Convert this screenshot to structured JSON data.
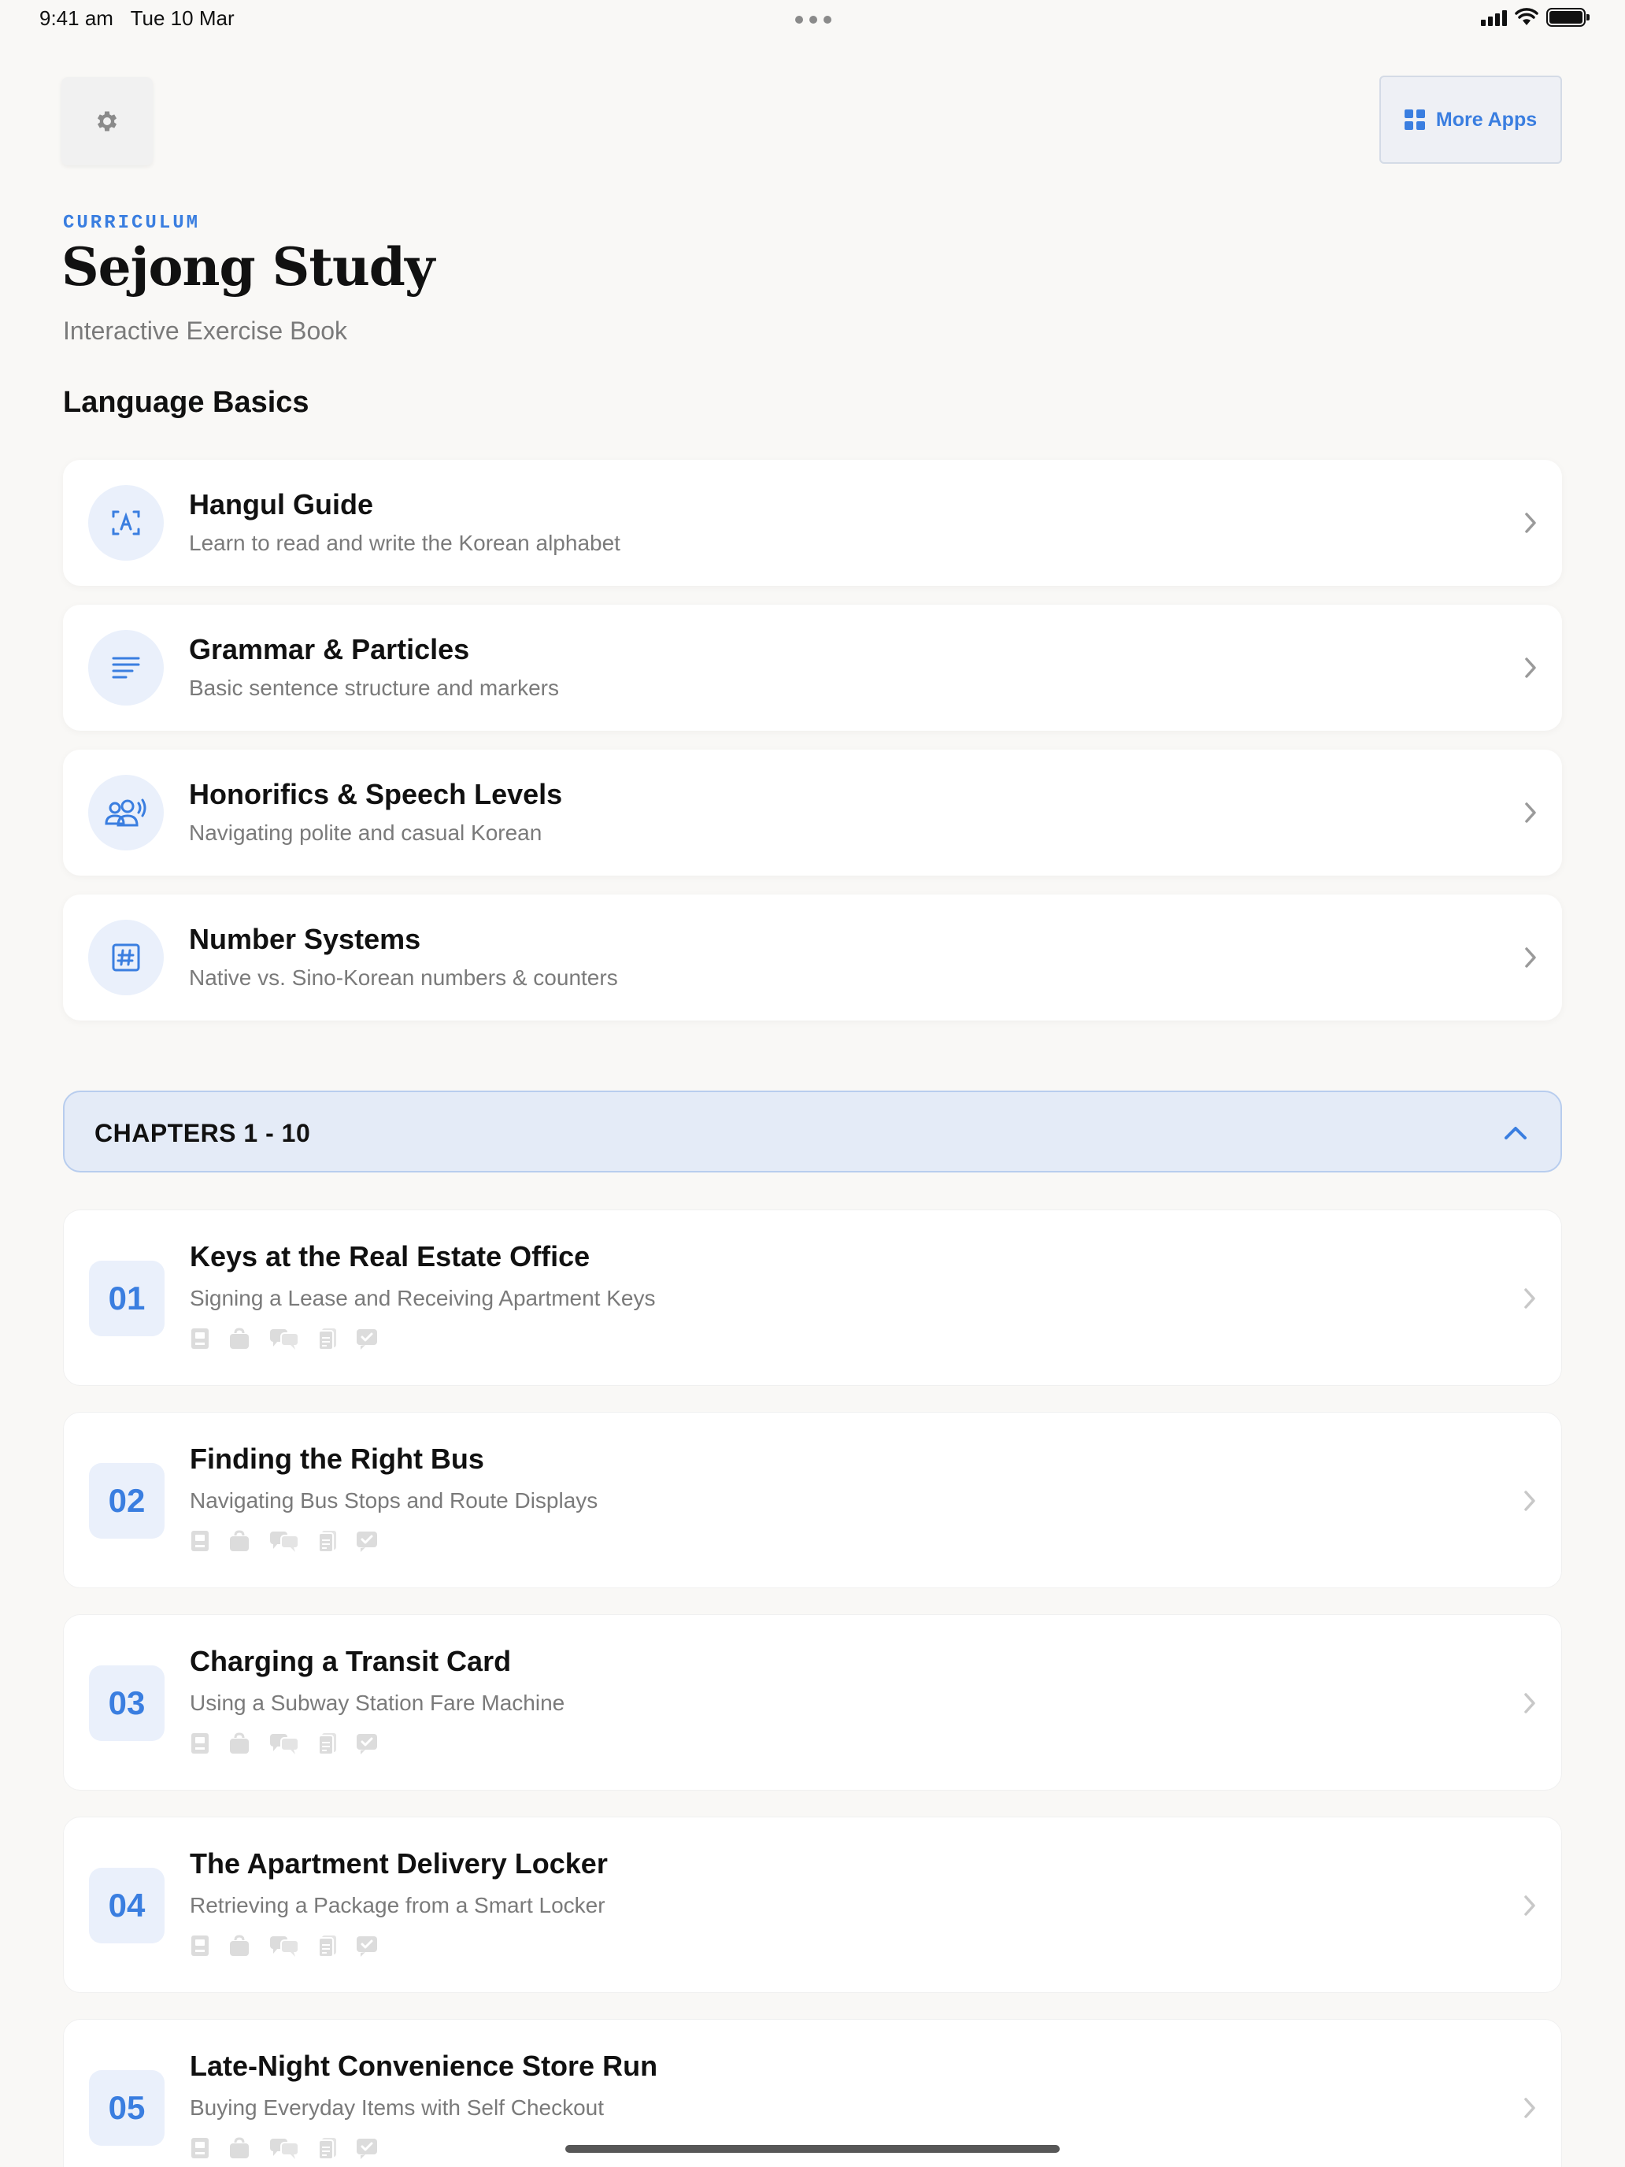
{
  "status_bar": {
    "time": "9:41 am",
    "date": "Tue 10 Mar"
  },
  "toolbar": {
    "settings_icon": "gear-icon",
    "more_apps_label": "More Apps",
    "more_apps_icon": "grid-icon"
  },
  "header": {
    "eyebrow": "CURRICULUM",
    "title": "Sejong Study",
    "subtitle": "Interactive Exercise Book"
  },
  "basics": {
    "section_title": "Language Basics",
    "items": [
      {
        "title": "Hangul Guide",
        "subtitle": "Learn to read and write the Korean alphabet",
        "icon": "alphabet-icon"
      },
      {
        "title": "Grammar & Particles",
        "subtitle": "Basic sentence structure and markers",
        "icon": "text-lines-icon"
      },
      {
        "title": "Honorifics & Speech Levels",
        "subtitle": "Navigating polite and casual Korean",
        "icon": "people-speaking-icon"
      },
      {
        "title": "Number Systems",
        "subtitle": "Native vs. Sino-Korean numbers & counters",
        "icon": "hash-icon"
      }
    ]
  },
  "chapters": {
    "group_label": "CHAPTERS 1 - 10",
    "items": [
      {
        "number": "01",
        "title": "Keys at the Real Estate Office",
        "subtitle": "Signing a Lease and Receiving Apartment Keys"
      },
      {
        "number": "02",
        "title": "Finding the Right Bus",
        "subtitle": "Navigating Bus Stops and Route Displays"
      },
      {
        "number": "03",
        "title": "Charging a Transit Card",
        "subtitle": "Using a Subway Station Fare Machine"
      },
      {
        "number": "04",
        "title": "The Apartment Delivery Locker",
        "subtitle": "Retrieving a Package from a Smart Locker"
      },
      {
        "number": "05",
        "title": "Late-Night Convenience Store Run",
        "subtitle": "Buying Everyday Items with Self Checkout"
      }
    ],
    "activity_icons": [
      "book-icon",
      "bag-icon",
      "chat-bubbles-icon",
      "document-icon",
      "checkmark-icon"
    ]
  },
  "colors": {
    "accent": "#3a7ee0",
    "background": "#f9f8f6",
    "icon_bg": "#eaf0fb",
    "muted_text": "#7a7a7a"
  }
}
